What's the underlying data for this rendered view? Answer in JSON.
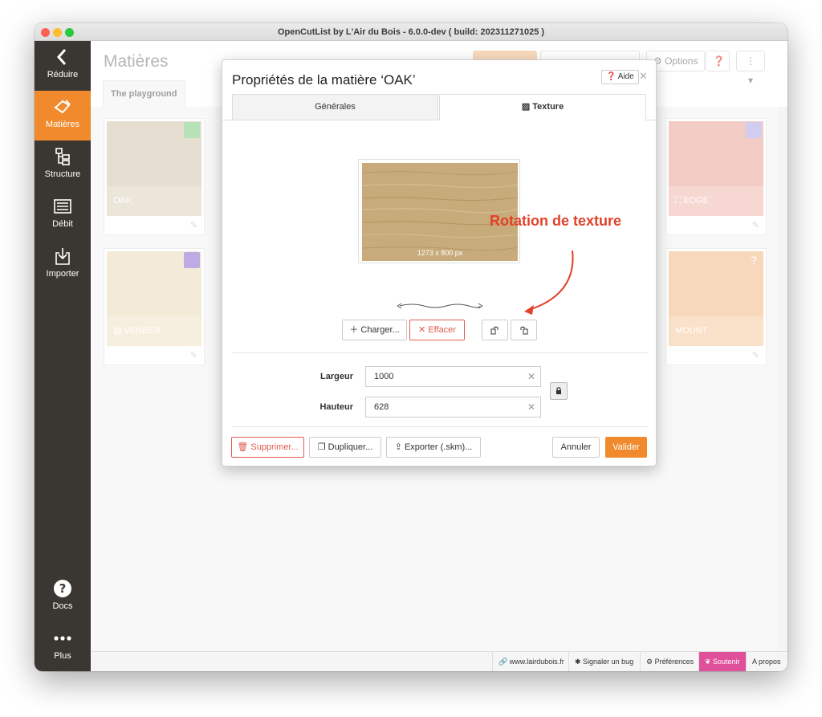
{
  "window": {
    "title": "OpenCutList by L'Air du Bois - 6.0.0-dev ( build: 202311271025 )"
  },
  "sidebar": {
    "items": [
      {
        "label": "Réduire",
        "icon": "chevron-left-icon"
      },
      {
        "label": "Matières",
        "icon": "materials-icon"
      },
      {
        "label": "Structure",
        "icon": "structure-icon"
      },
      {
        "label": "Débit",
        "icon": "cutlist-icon"
      },
      {
        "label": "Importer",
        "icon": "import-icon"
      }
    ],
    "bottom": [
      {
        "label": "Docs",
        "icon": "question-icon"
      },
      {
        "label": "Plus",
        "icon": "more-icon"
      }
    ]
  },
  "main": {
    "title": "Matières",
    "options_label": "Options",
    "tab_label": "The playground",
    "cards": [
      {
        "label": "OAK",
        "color": "#d8ccb8"
      },
      {
        "label": "VENEER",
        "color": "#eedfc3"
      },
      {
        "label": "EDGE",
        "color": "#eeb1a8"
      },
      {
        "label": "MOUNT",
        "color": "#f5c497"
      }
    ]
  },
  "status": {
    "site": "www.lairdubois.fr",
    "bug": "Signaler un bug",
    "prefs": "Préférences",
    "support": "Soutenir",
    "about": "A propos"
  },
  "modal": {
    "title": "Propriétés de la matière ‘OAK’",
    "help_label": "Aide",
    "tabs": [
      {
        "label": "Générales"
      },
      {
        "label": "Texture"
      }
    ],
    "texture_dims": "1273 x 800 px",
    "load_label": "Charger...",
    "clear_label": "Effacer",
    "width_label": "Largeur",
    "width_value": "1000",
    "height_label": "Hauteur",
    "height_value": "628",
    "delete_label": "Supprimer...",
    "duplicate_label": "Dupliquer...",
    "export_label": "Exporter (.skm)...",
    "cancel_label": "Annuler",
    "ok_label": "Valider"
  },
  "annotation": "Rotation de texture",
  "colors": {
    "accent": "#f08a2c",
    "danger": "#e25a4d",
    "sidebar": "#3a3631",
    "support": "#e0509a",
    "annotation": "#e2412a"
  }
}
